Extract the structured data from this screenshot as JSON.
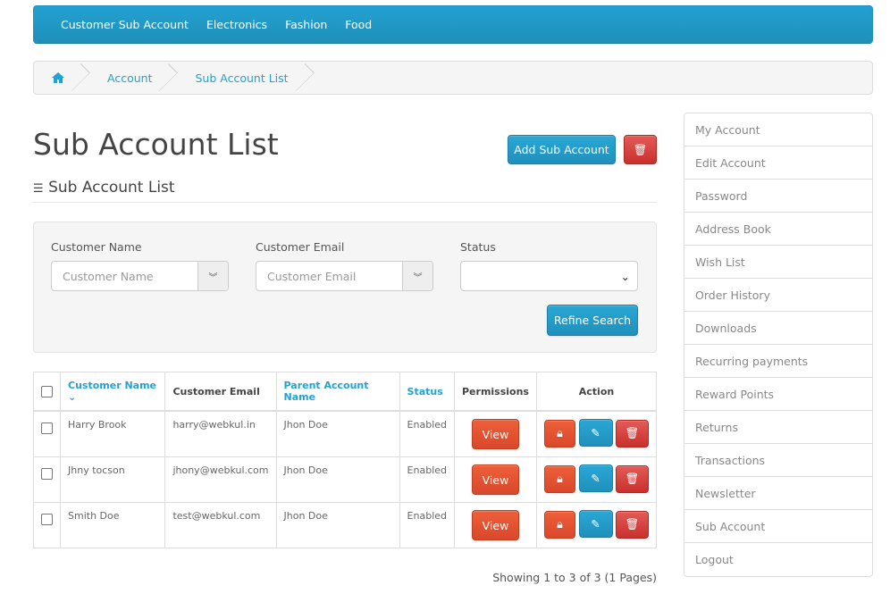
{
  "nav": {
    "items": [
      "Customer Sub Account",
      "Electronics",
      "Fashion",
      "Food"
    ]
  },
  "breadcrumb": {
    "home_icon": "home-icon",
    "items": [
      "Account",
      "Sub Account List"
    ]
  },
  "page": {
    "title": "Sub Account List",
    "subtitle": "Sub Account List",
    "add_label": "Add Sub Account"
  },
  "filter": {
    "name_label": "Customer Name",
    "name_placeholder": "Customer Name",
    "email_label": "Customer Email",
    "email_placeholder": "Customer Email",
    "status_label": "Status",
    "status_value": "",
    "refine_label": "Refine Search"
  },
  "table": {
    "headers": [
      "Customer Name",
      "Customer Email",
      "Parent Account Name",
      "Status",
      "Permissions",
      "Action"
    ],
    "rows": [
      {
        "name": "Harry Brook",
        "email": "harry@webkul.in",
        "parent": "Jhon Doe",
        "status": "Enabled",
        "perm": "View"
      },
      {
        "name": "Jhny tocson",
        "email": "jhony@webkul.com",
        "parent": "Jhon Doe",
        "status": "Enabled",
        "perm": "View"
      },
      {
        "name": "Smith Doe",
        "email": "test@webkul.com",
        "parent": "Jhon Doe",
        "status": "Enabled",
        "perm": "View"
      }
    ]
  },
  "pagination": "Showing 1 to 3 of 3 (1 Pages)",
  "sidebar": [
    "My Account",
    "Edit Account",
    "Password",
    "Address Book",
    "Wish List",
    "Order History",
    "Downloads",
    "Recurring payments",
    "Reward Points",
    "Returns",
    "Transactions",
    "Newsletter",
    "Sub Account",
    "Logout"
  ],
  "colors": {
    "primary": "#23a1d1",
    "danger": "#d9534f",
    "warning": "#e4532f"
  }
}
